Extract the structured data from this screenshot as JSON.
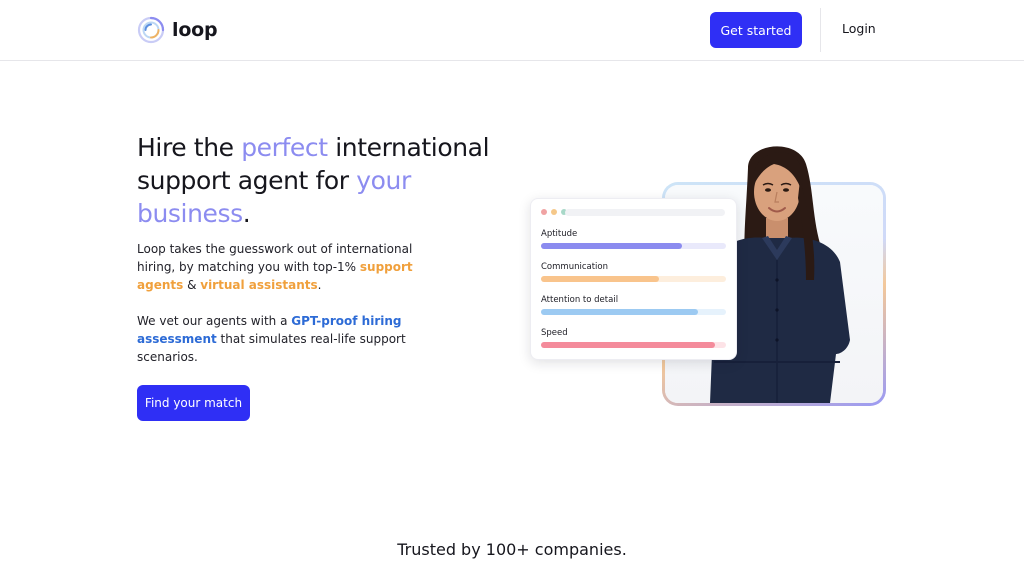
{
  "header": {
    "logo_text": "loop",
    "get_started_label": "Get started",
    "login_label": "Login"
  },
  "hero": {
    "title_part1": "Hire the ",
    "title_accent1": "perfect",
    "title_part2": " international support agent for ",
    "title_accent2": "your business",
    "title_end": ".",
    "p1_text1": "Loop takes the guesswork out of international hiring, by matching you with top-1% ",
    "p1_link1": "support agents",
    "p1_text2": " & ",
    "p1_link2": "virtual assistants",
    "p1_text3": ".",
    "p2_text1": "We vet our agents with a ",
    "p2_link": "GPT-proof hiring assessment",
    "p2_text2": " that simulates real-life support scenarios.",
    "cta_label": "Find your match"
  },
  "card": {
    "window_dot_colors": [
      "#f0a3a3",
      "#f5c88a",
      "#a8d8c8"
    ],
    "metrics": [
      {
        "label": "Aptitude",
        "value": 0.76,
        "fill": "#8b8bef",
        "track": "#e9e9fb"
      },
      {
        "label": "Communication",
        "value": 0.64,
        "fill": "#f9c48c",
        "track": "#fdeedd"
      },
      {
        "label": "Attention to detail",
        "value": 0.85,
        "fill": "#9ccaf2",
        "track": "#e6f2fc"
      },
      {
        "label": "Speed",
        "value": 0.94,
        "fill": "#f48b9b",
        "track": "#fde3e7"
      }
    ]
  },
  "colors": {
    "brand": "#2f2ff5",
    "accent_purple": "#8c8cf0",
    "accent_orange": "#f0a03c",
    "accent_blue": "#2d6bd6"
  },
  "trusted_text": "Trusted by 100+ companies."
}
